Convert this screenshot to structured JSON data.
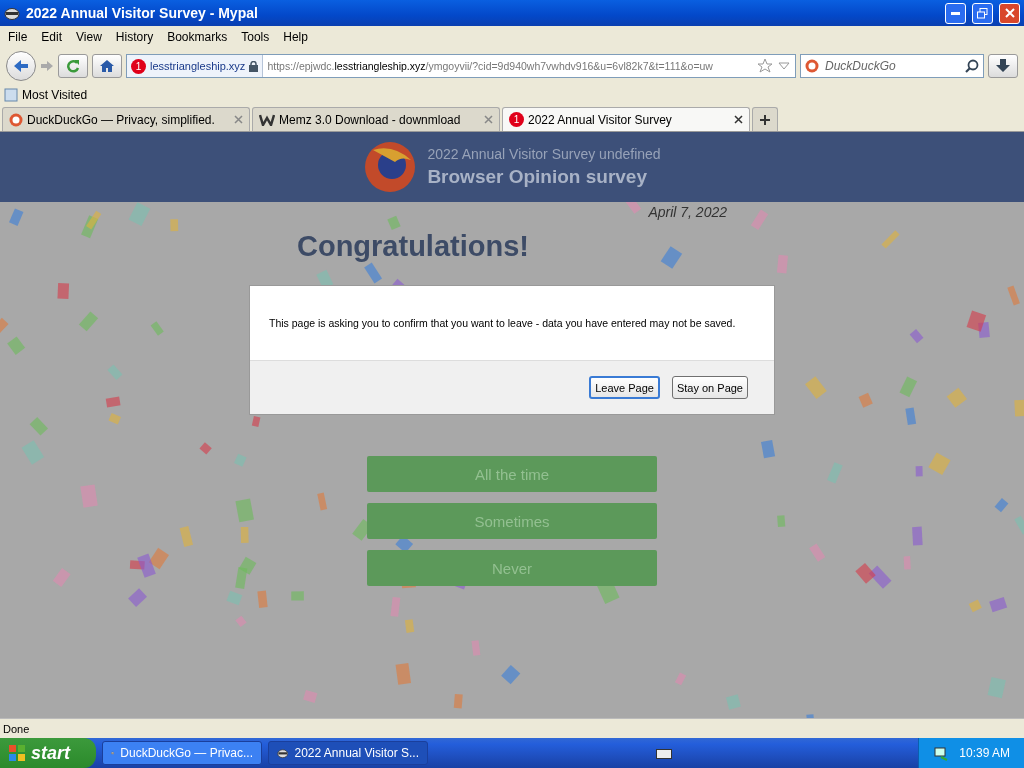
{
  "window": {
    "title": "2022 Annual Visitor Survey - Mypal"
  },
  "menu": [
    "File",
    "Edit",
    "View",
    "History",
    "Bookmarks",
    "Tools",
    "Help"
  ],
  "address": {
    "badge": "1",
    "identity": "lesstriangleship.xyz",
    "prefix": "https://epjwdc.",
    "domain": "lesstriangleship.xyz",
    "path": "/ymgoyvii/?cid=9d940wh7vwhdv916&u=6vl82k7&t=111&o=uw"
  },
  "search": {
    "placeholder": "DuckDuckGo"
  },
  "bookmarks": [
    "Most Visited"
  ],
  "tabs": [
    {
      "label": "DuckDuckGo — Privacy, simplified.",
      "kind": "duck",
      "selected": false
    },
    {
      "label": "Memz 3.0 Download - downmload",
      "kind": "w",
      "selected": false
    },
    {
      "label": "2022 Annual Visitor Survey",
      "kind": "alert",
      "badge": "1",
      "selected": true
    }
  ],
  "page": {
    "subtitle": "2022 Annual Visitor Survey undefined",
    "title": "Browser Opinion survey",
    "date": "April 7, 2022",
    "heading": "Congratulations!",
    "answers": [
      "All the time",
      "Sometimes",
      "Never"
    ]
  },
  "dialog": {
    "message": "This page is asking you to confirm that you want to leave - data you have entered may not be saved.",
    "buttons": [
      {
        "label": "Leave Page",
        "focused": true
      },
      {
        "label": "Stay on Page",
        "focused": false
      }
    ]
  },
  "status_bar": "Done",
  "taskbar": {
    "start": "start",
    "tasks": [
      {
        "label": "DuckDuckGo — Privac...",
        "selected": false
      },
      {
        "label": "2022 Annual Visitor S...",
        "selected": true
      }
    ],
    "clock": "10:39 AM"
  }
}
